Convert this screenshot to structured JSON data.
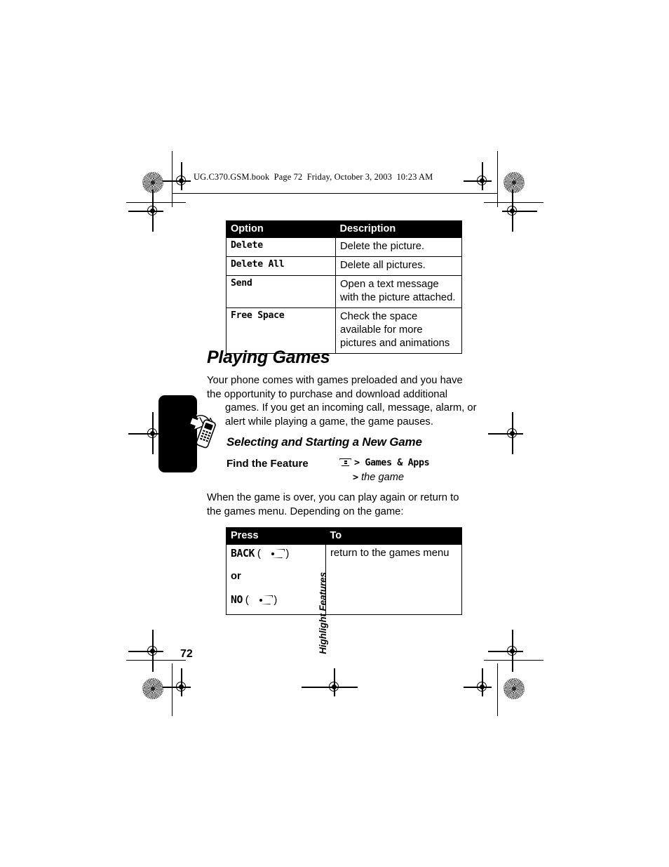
{
  "page": {
    "file_header": "UG.C370.GSM.book  Page 72  Friday, October 3, 2003  10:23 AM",
    "page_number": "72",
    "sidebar_label": "Highlight Features",
    "sidebar_icon": "phone-refresh-icon"
  },
  "options_table": {
    "name": "picture-options-table",
    "headers": [
      "Option",
      "Description"
    ],
    "rows": [
      {
        "option": "Delete",
        "description": "Delete the picture."
      },
      {
        "option": "Delete All",
        "description": "Delete all pictures."
      },
      {
        "option": "Send",
        "description": "Open a text message with the picture attached."
      },
      {
        "option": "Free Space",
        "description": "Check the space available for more pictures and animations"
      }
    ]
  },
  "section": {
    "title": "Playing Games",
    "intro_lines": [
      "Your phone comes with games preloaded and you have",
      "the opportunity to purchase and download additional",
      "games. If you get an incoming call, message, alarm, or",
      "alert while playing a game, the game pauses."
    ],
    "subsection_title": "Selecting and Starting a New Game",
    "find_the_feature": {
      "label": "Find the Feature",
      "menu_icon": "menu-key-icon",
      "path": "> Games & Apps",
      "sub_path_arrow": ">",
      "sub_path": "the game"
    },
    "resume_text": "When the game is over, you can play again or return to the games menu. Depending on the game:"
  },
  "press_table": {
    "name": "press-to-table",
    "headers": [
      "Press",
      "To"
    ],
    "rows": [
      {
        "press_label": "BACK",
        "key_icon": "soft-key-icon",
        "to": "return to the games menu"
      },
      {
        "press_label": "or",
        "key_icon": null,
        "to": ""
      },
      {
        "press_label": "NO",
        "key_icon": "soft-key-icon",
        "to": ""
      }
    ]
  }
}
